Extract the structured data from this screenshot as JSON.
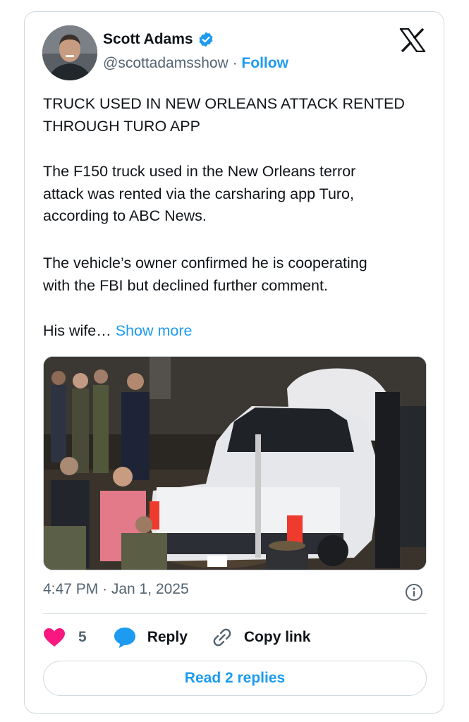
{
  "author": {
    "name": "Scott Adams",
    "handle": "@scottadamsshow",
    "separator": "·",
    "follow_label": "Follow",
    "verified_icon": "verified-badge-icon"
  },
  "brand": {
    "logo": "x-logo-icon"
  },
  "tweet": {
    "headline_line1": "TRUCK USED IN NEW ORLEANS ATTACK RENTED",
    "headline_line2": "THROUGH TURO APP",
    "para1_line1": "The F150 truck used in the New Orleans terror",
    "para1_line2": "attack was rented via the carsharing app Turo,",
    "para1_line3": "according to ABC News.",
    "para2_line1": "The vehicle’s owner confirmed he is cooperating",
    "para2_line2": "with the FBI but declined further comment.",
    "para3": "His wife…",
    "show_more": "Show more"
  },
  "media": {
    "type": "photo"
  },
  "meta": {
    "time": "4:47 PM · Jan 1, 2025",
    "info_icon": "info-icon"
  },
  "actions": {
    "like_count": "5",
    "reply_label": "Reply",
    "copy_label": "Copy link"
  },
  "read_replies": "Read 2 replies",
  "colors": {
    "accent": "#1d9bf0",
    "like": "#f91880",
    "text": "#0f1419",
    "muted": "#536471",
    "border": "#cfd9de"
  }
}
